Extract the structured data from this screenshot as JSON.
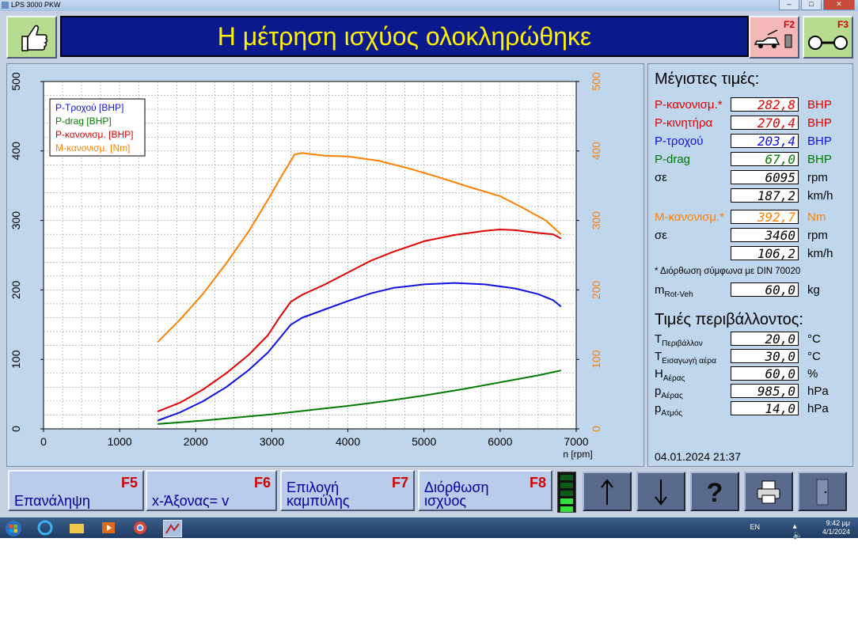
{
  "window": {
    "title": "LPS 3000 PKW"
  },
  "header": {
    "title": "Η μέτρηση ισχύος ολοκληρώθηκε"
  },
  "topkeys": {
    "f2": "F2",
    "f3": "F3"
  },
  "colors": {
    "red": "#e00000",
    "blue": "#1010e0",
    "green": "#007a00",
    "orange": "#ff8000",
    "header_bg": "#0a1a8c",
    "header_text": "#fff200"
  },
  "icons": {
    "thumb": "thumbs-up-icon",
    "f2": "car-on-dyno-icon",
    "f3": "roller-dyno-icon"
  },
  "chart_data": {
    "type": "line",
    "xlabel": "n [rpm]",
    "x_ticks": [
      0,
      1000,
      2000,
      3000,
      4000,
      5000,
      6000,
      7000
    ],
    "xlim": [
      0,
      7000
    ],
    "ylim_left": [
      0,
      500
    ],
    "ylim_right": [
      0,
      500
    ],
    "y_ticks": [
      0,
      100,
      200,
      300,
      400,
      500
    ],
    "grid": true,
    "legend_position": "top-left",
    "series": [
      {
        "name": "P-Τροχού [BHP]",
        "color": "#1010e0",
        "axis": "left",
        "x": [
          1500,
          1800,
          2100,
          2400,
          2700,
          2950,
          3100,
          3250,
          3400,
          3700,
          4000,
          4300,
          4600,
          5000,
          5400,
          5800,
          6200,
          6500,
          6700,
          6800
        ],
        "y": [
          12,
          24,
          40,
          60,
          85,
          110,
          130,
          150,
          160,
          172,
          184,
          195,
          203,
          208,
          210,
          208,
          202,
          194,
          185,
          176
        ]
      },
      {
        "name": "P-drag [BHP]",
        "color": "#007a00",
        "axis": "left",
        "x": [
          1500,
          2000,
          2500,
          3000,
          3500,
          4000,
          4500,
          5000,
          5500,
          6000,
          6500,
          6800
        ],
        "y": [
          7,
          11,
          16,
          21,
          27,
          33,
          40,
          48,
          57,
          67,
          77,
          84
        ]
      },
      {
        "name": "P-κανονισμ. [BHP]",
        "color": "#e00000",
        "axis": "left",
        "x": [
          1500,
          1800,
          2100,
          2400,
          2700,
          2950,
          3100,
          3250,
          3400,
          3700,
          4000,
          4300,
          4600,
          5000,
          5400,
          5800,
          6000,
          6200,
          6500,
          6700,
          6800
        ],
        "y": [
          25,
          38,
          57,
          80,
          107,
          135,
          160,
          183,
          193,
          208,
          225,
          242,
          255,
          270,
          279,
          285,
          287,
          286,
          282,
          280,
          274
        ]
      },
      {
        "name": "Μ-κανονισμ. [Nm]",
        "color": "#ff8000",
        "axis": "right",
        "x": [
          1500,
          1800,
          2100,
          2400,
          2700,
          2950,
          3150,
          3300,
          3400,
          3700,
          4000,
          4400,
          4800,
          5200,
          5600,
          6000,
          6300,
          6600,
          6800
        ],
        "y": [
          125,
          158,
          195,
          238,
          285,
          330,
          368,
          395,
          397,
          393,
          392,
          386,
          375,
          362,
          348,
          335,
          318,
          300,
          280
        ]
      }
    ]
  },
  "maxvalues": {
    "title": "Μέγιστες τιμές:",
    "rows": [
      {
        "label": "P-κανονισμ.*",
        "value": "282,8",
        "unit": "BHP",
        "color": "red"
      },
      {
        "label": "P-κινητήρα",
        "value": "270,4",
        "unit": "BHP",
        "color": "red"
      },
      {
        "label": "P-τροχού",
        "value": "203,4",
        "unit": "BHP",
        "color": "blue"
      },
      {
        "label": "P-drag",
        "value": "67,0",
        "unit": "BHP",
        "color": "green"
      },
      {
        "label": "σε",
        "value": "6095",
        "unit": "rpm",
        "color": "black"
      },
      {
        "label": "",
        "value": "187,2",
        "unit": "km/h",
        "color": "black"
      }
    ],
    "torque_rows": [
      {
        "label": "Μ-κανονισμ.*",
        "value": "392,7",
        "unit": "Nm",
        "color": "orange"
      },
      {
        "label": "σε",
        "value": "3460",
        "unit": "rpm",
        "color": "black"
      },
      {
        "label": "",
        "value": "106,2",
        "unit": "km/h",
        "color": "black"
      }
    ],
    "footnote": "* Διόρθωση σύμφωνα με DIN 70020",
    "mass": {
      "label": "m",
      "sub": "Rot-Veh",
      "value": "60,0",
      "unit": "kg"
    }
  },
  "env": {
    "title": "Τιμές περιβάλλοντος:",
    "rows": [
      {
        "label": "T",
        "sub": "Περιβάλλον",
        "value": "20,0",
        "unit": "°C"
      },
      {
        "label": "T",
        "sub": "Εισαγωγή αέρα",
        "value": "30,0",
        "unit": "°C"
      },
      {
        "label": "H",
        "sub": "Αέρας",
        "value": "60,0",
        "unit": "%"
      },
      {
        "label": "p",
        "sub": "Αέρας",
        "value": "985,0",
        "unit": "hPa"
      },
      {
        "label": "p",
        "sub": "Ατμός",
        "value": "14,0",
        "unit": "hPa"
      }
    ]
  },
  "datetime": "04.01.2024   21:37",
  "fkeys": [
    {
      "key": "F5",
      "label": "Επανάληψη"
    },
    {
      "key": "F6",
      "label": "x-Άξονας= v"
    },
    {
      "key": "F7",
      "label": "Επιλογή καμπύλης"
    },
    {
      "key": "F8",
      "label": "Διόρθωση ισχύος"
    }
  ],
  "taskbar": {
    "lang": "EN",
    "time": "9:42 μμ",
    "date": "4/1/2024"
  }
}
